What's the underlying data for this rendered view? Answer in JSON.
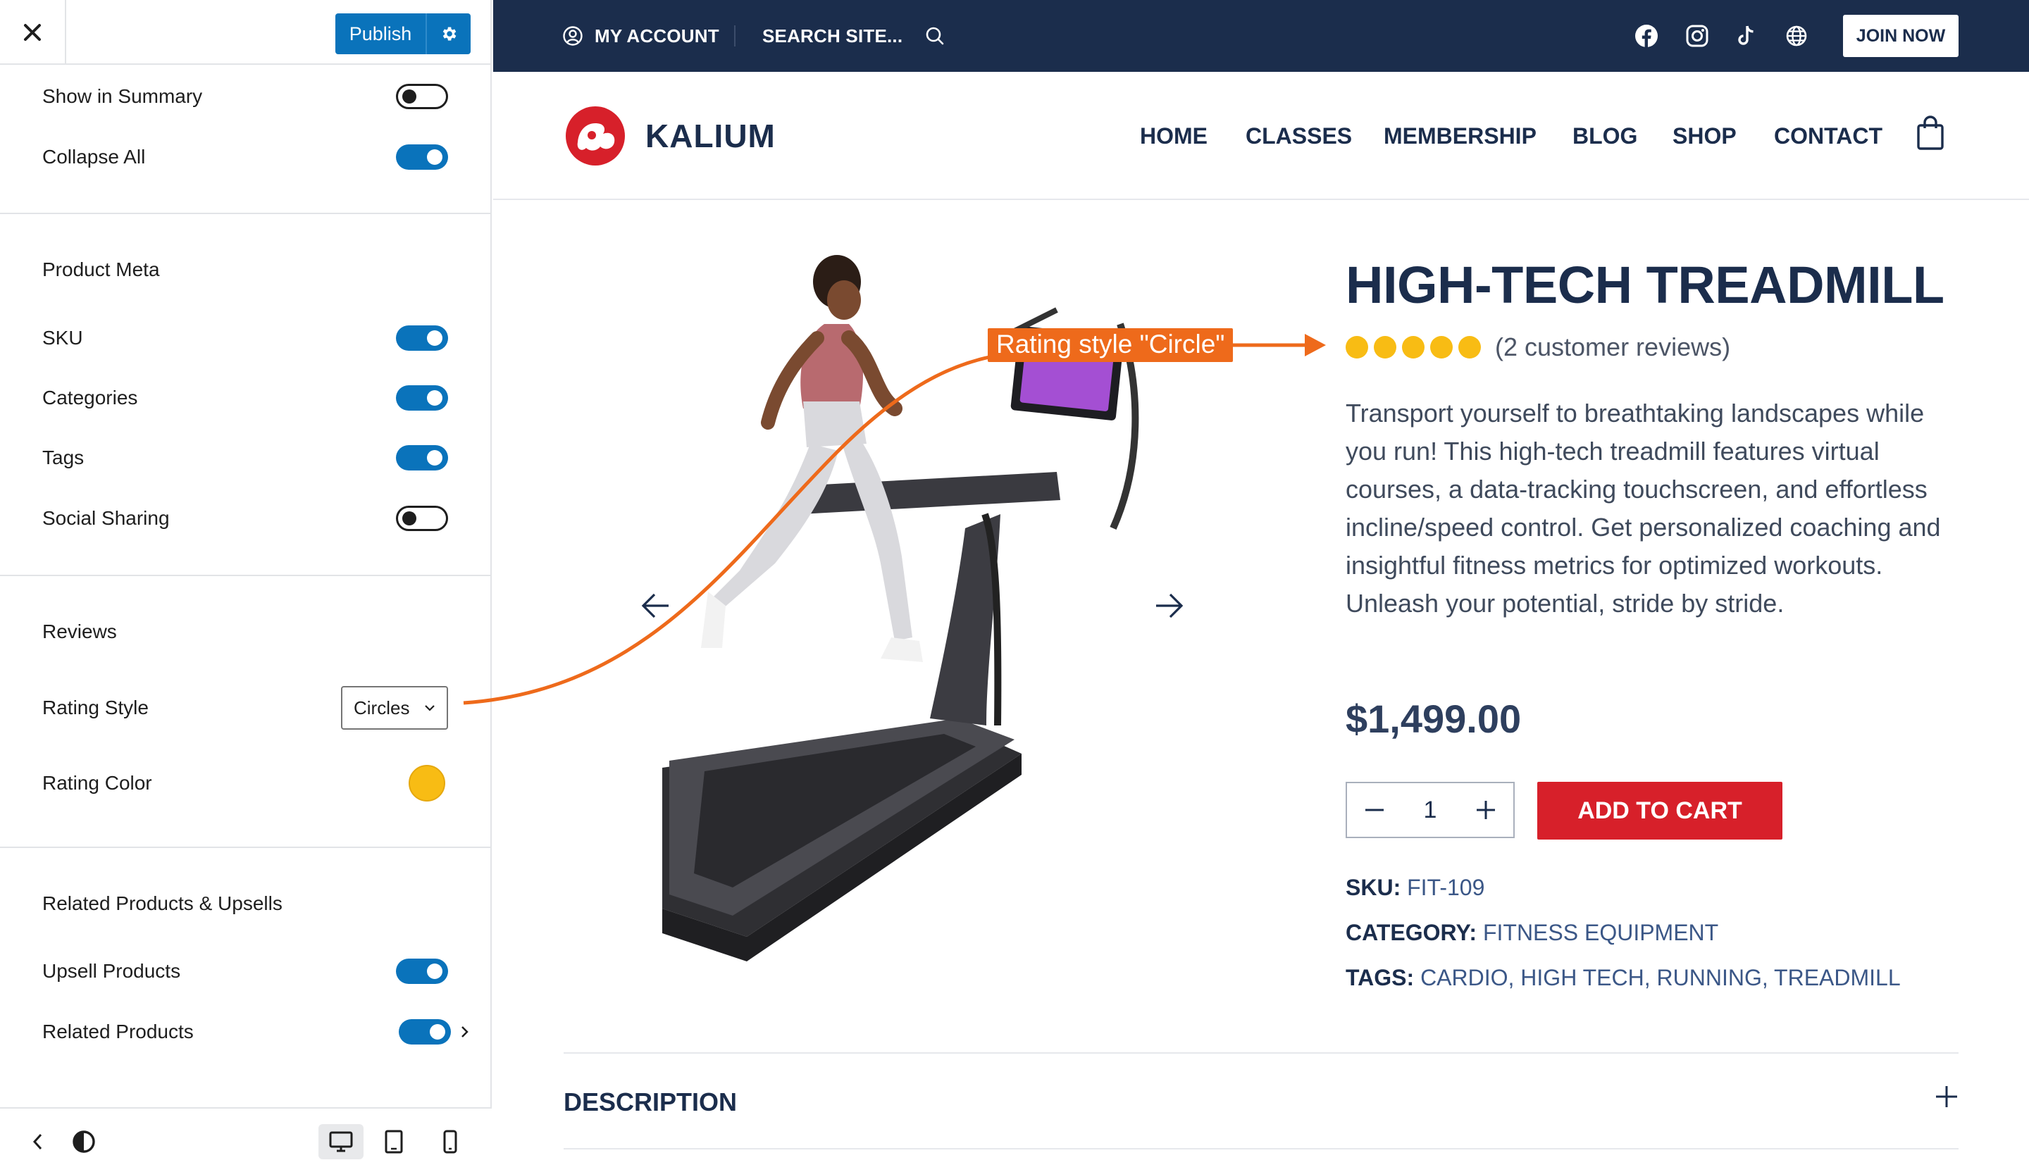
{
  "sidebar": {
    "publish_label": "Publish",
    "rows_top": [
      {
        "label": "Show in Summary",
        "on": false
      },
      {
        "label": "Collapse All",
        "on": true
      }
    ],
    "product_meta": {
      "heading": "Product Meta",
      "rows": [
        {
          "label": "SKU",
          "on": true
        },
        {
          "label": "Categories",
          "on": true
        },
        {
          "label": "Tags",
          "on": true
        },
        {
          "label": "Social Sharing",
          "on": false
        }
      ]
    },
    "reviews": {
      "heading": "Reviews",
      "rating_style_label": "Rating Style",
      "rating_style_value": "Circles",
      "rating_color_label": "Rating Color",
      "rating_color": "#f8bc14"
    },
    "related": {
      "heading": "Related Products & Upsells",
      "rows": [
        {
          "label": "Upsell Products",
          "on": true
        },
        {
          "label": "Related Products",
          "on": true
        }
      ]
    }
  },
  "topbar": {
    "account": "MY ACCOUNT",
    "search": "SEARCH SITE...",
    "join": "JOIN NOW"
  },
  "header": {
    "brand": "KALIUM",
    "nav": [
      "HOME",
      "CLASSES",
      "MEMBERSHIP",
      "BLOG",
      "SHOP",
      "CONTACT"
    ]
  },
  "product": {
    "title": "HIGH-TECH TREADMILL",
    "rating_count": 5,
    "reviews": "(2 customer reviews)",
    "description": "Transport yourself to breathtaking landscapes while you run! This high-tech treadmill features virtual courses, a data-tracking touchscreen, and effortless incline/speed control. Get personalized coaching and insightful fitness metrics for optimized workouts. Unleash your potential, stride by stride.",
    "price": "$1,499.00",
    "quantity": "1",
    "add_to_cart": "ADD TO CART",
    "sku_label": "SKU:",
    "sku": "FIT-109",
    "category_label": "CATEGORY:",
    "category": "FITNESS EQUIPMENT",
    "tags_label": "TAGS:",
    "tags": "CARDIO, HIGH TECH, RUNNING, TREADMILL"
  },
  "description_tab": "DESCRIPTION",
  "annotation": {
    "callout": "Rating style \"Circle\"",
    "color": "#ee6a1b"
  },
  "colors": {
    "accent_blue": "#0a73bb",
    "navy": "#1b2d4c",
    "brand_red": "#d7202a",
    "rating_yellow": "#f8bc14"
  }
}
